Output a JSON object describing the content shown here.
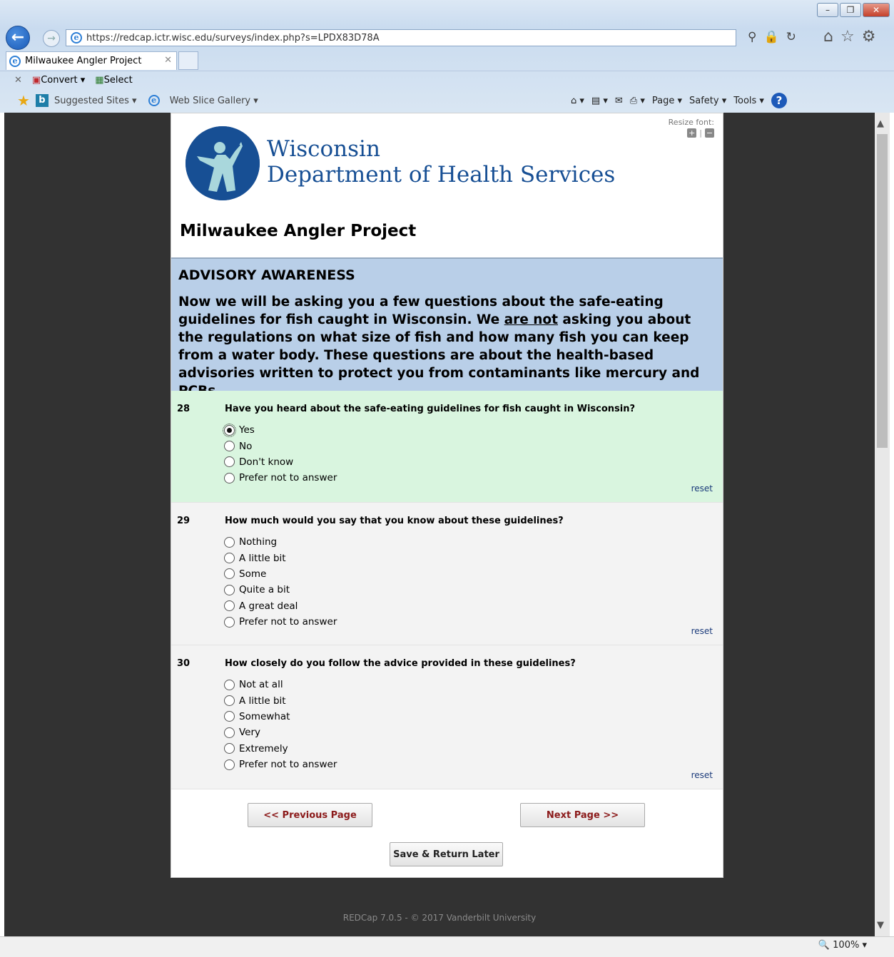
{
  "browser": {
    "url": "https://redcap.ictr.wisc.edu/surveys/index.php?s=LPDX83D78A",
    "tab_title": "Milwaukee Angler Project",
    "command_bar": {
      "convert": "Convert",
      "select": "Select"
    },
    "favorites": {
      "suggested": "Suggested Sites",
      "webslice": "Web Slice Gallery"
    },
    "toolbar": {
      "page": "Page",
      "safety": "Safety",
      "tools": "Tools"
    },
    "zoom": "100%"
  },
  "header": {
    "agency_line1": "Wisconsin",
    "agency_line2": "Department of Health Services",
    "resize_font_label": "Resize font:",
    "survey_title": "Milwaukee Angler Project"
  },
  "section": {
    "title": "ADVISORY AWARENESS",
    "text_before": "Now we will be asking you a few questions about the safe-eating guidelines for fish caught in Wisconsin. We ",
    "text_underline": "are not",
    "text_after": " asking you about the regulations on what size of fish and how many fish you can keep from a water body. These questions are about the health-based advisories written to protect you from contaminants like mercury and PCBs."
  },
  "questions": [
    {
      "number": "28",
      "text": "Have you heard about the safe-eating guidelines for fish caught in Wisconsin?",
      "choices": [
        "Yes",
        "No",
        "Don't know",
        "Prefer not to answer"
      ],
      "selected": "Yes"
    },
    {
      "number": "29",
      "text": "How much would you say that you know about these guidelines?",
      "choices": [
        "Nothing",
        "A little bit",
        "Some",
        "Quite a bit",
        "A great deal",
        "Prefer not to answer"
      ],
      "selected": null
    },
    {
      "number": "30",
      "text": "How closely do you follow the advice provided in these guidelines?",
      "choices": [
        "Not at all",
        "A little bit",
        "Somewhat",
        "Very",
        "Extremely",
        "Prefer not to answer"
      ],
      "selected": null
    }
  ],
  "reset_label": "reset",
  "buttons": {
    "previous": "<< Previous Page",
    "next": "Next Page >>",
    "save": "Save & Return Later"
  },
  "footer": "REDCap 7.0.5 - © 2017 Vanderbilt University"
}
